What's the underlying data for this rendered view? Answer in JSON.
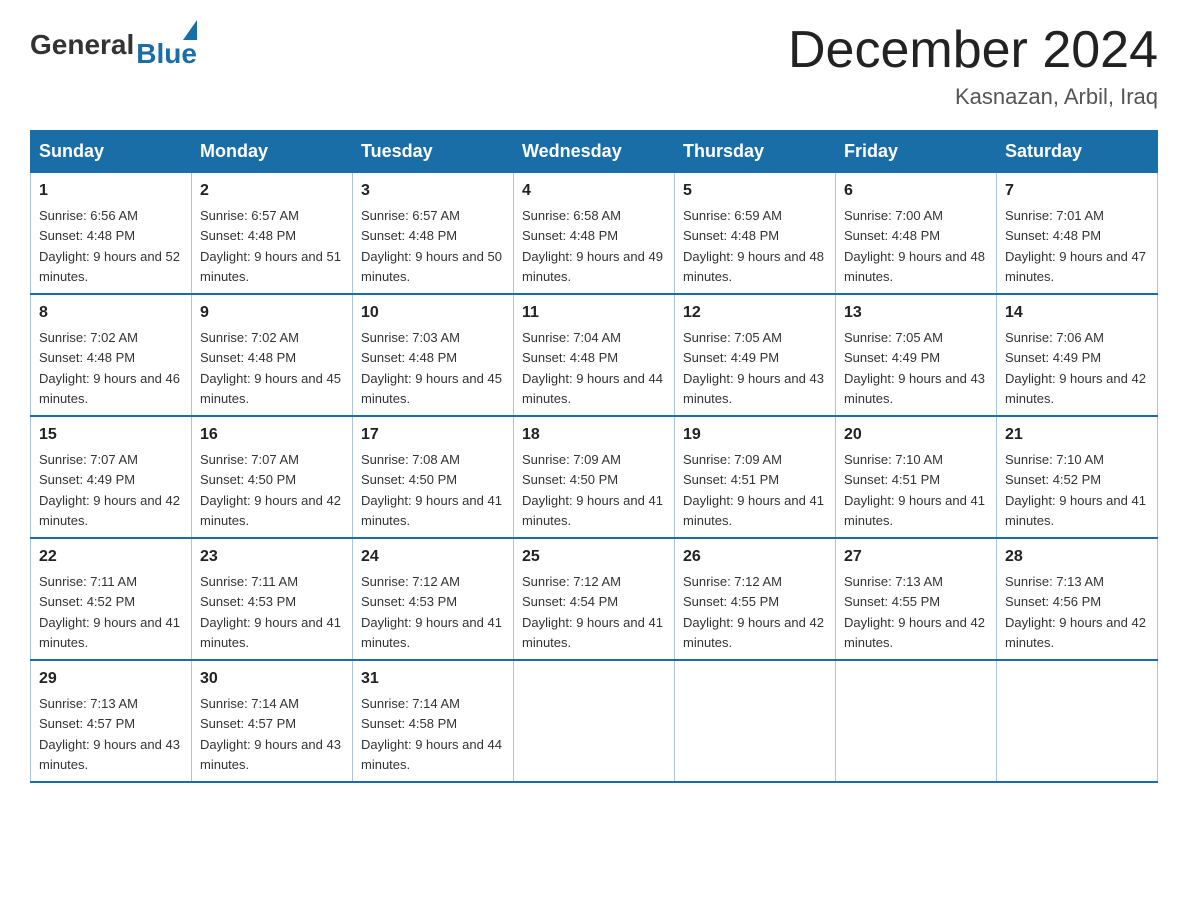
{
  "logo": {
    "general": "General",
    "blue": "Blue"
  },
  "title": {
    "month_year": "December 2024",
    "location": "Kasnazan, Arbil, Iraq"
  },
  "days_of_week": [
    "Sunday",
    "Monday",
    "Tuesday",
    "Wednesday",
    "Thursday",
    "Friday",
    "Saturday"
  ],
  "weeks": [
    [
      {
        "day": "1",
        "sunrise": "6:56 AM",
        "sunset": "4:48 PM",
        "daylight": "9 hours and 52 minutes."
      },
      {
        "day": "2",
        "sunrise": "6:57 AM",
        "sunset": "4:48 PM",
        "daylight": "9 hours and 51 minutes."
      },
      {
        "day": "3",
        "sunrise": "6:57 AM",
        "sunset": "4:48 PM",
        "daylight": "9 hours and 50 minutes."
      },
      {
        "day": "4",
        "sunrise": "6:58 AM",
        "sunset": "4:48 PM",
        "daylight": "9 hours and 49 minutes."
      },
      {
        "day": "5",
        "sunrise": "6:59 AM",
        "sunset": "4:48 PM",
        "daylight": "9 hours and 48 minutes."
      },
      {
        "day": "6",
        "sunrise": "7:00 AM",
        "sunset": "4:48 PM",
        "daylight": "9 hours and 48 minutes."
      },
      {
        "day": "7",
        "sunrise": "7:01 AM",
        "sunset": "4:48 PM",
        "daylight": "9 hours and 47 minutes."
      }
    ],
    [
      {
        "day": "8",
        "sunrise": "7:02 AM",
        "sunset": "4:48 PM",
        "daylight": "9 hours and 46 minutes."
      },
      {
        "day": "9",
        "sunrise": "7:02 AM",
        "sunset": "4:48 PM",
        "daylight": "9 hours and 45 minutes."
      },
      {
        "day": "10",
        "sunrise": "7:03 AM",
        "sunset": "4:48 PM",
        "daylight": "9 hours and 45 minutes."
      },
      {
        "day": "11",
        "sunrise": "7:04 AM",
        "sunset": "4:48 PM",
        "daylight": "9 hours and 44 minutes."
      },
      {
        "day": "12",
        "sunrise": "7:05 AM",
        "sunset": "4:49 PM",
        "daylight": "9 hours and 43 minutes."
      },
      {
        "day": "13",
        "sunrise": "7:05 AM",
        "sunset": "4:49 PM",
        "daylight": "9 hours and 43 minutes."
      },
      {
        "day": "14",
        "sunrise": "7:06 AM",
        "sunset": "4:49 PM",
        "daylight": "9 hours and 42 minutes."
      }
    ],
    [
      {
        "day": "15",
        "sunrise": "7:07 AM",
        "sunset": "4:49 PM",
        "daylight": "9 hours and 42 minutes."
      },
      {
        "day": "16",
        "sunrise": "7:07 AM",
        "sunset": "4:50 PM",
        "daylight": "9 hours and 42 minutes."
      },
      {
        "day": "17",
        "sunrise": "7:08 AM",
        "sunset": "4:50 PM",
        "daylight": "9 hours and 41 minutes."
      },
      {
        "day": "18",
        "sunrise": "7:09 AM",
        "sunset": "4:50 PM",
        "daylight": "9 hours and 41 minutes."
      },
      {
        "day": "19",
        "sunrise": "7:09 AM",
        "sunset": "4:51 PM",
        "daylight": "9 hours and 41 minutes."
      },
      {
        "day": "20",
        "sunrise": "7:10 AM",
        "sunset": "4:51 PM",
        "daylight": "9 hours and 41 minutes."
      },
      {
        "day": "21",
        "sunrise": "7:10 AM",
        "sunset": "4:52 PM",
        "daylight": "9 hours and 41 minutes."
      }
    ],
    [
      {
        "day": "22",
        "sunrise": "7:11 AM",
        "sunset": "4:52 PM",
        "daylight": "9 hours and 41 minutes."
      },
      {
        "day": "23",
        "sunrise": "7:11 AM",
        "sunset": "4:53 PM",
        "daylight": "9 hours and 41 minutes."
      },
      {
        "day": "24",
        "sunrise": "7:12 AM",
        "sunset": "4:53 PM",
        "daylight": "9 hours and 41 minutes."
      },
      {
        "day": "25",
        "sunrise": "7:12 AM",
        "sunset": "4:54 PM",
        "daylight": "9 hours and 41 minutes."
      },
      {
        "day": "26",
        "sunrise": "7:12 AM",
        "sunset": "4:55 PM",
        "daylight": "9 hours and 42 minutes."
      },
      {
        "day": "27",
        "sunrise": "7:13 AM",
        "sunset": "4:55 PM",
        "daylight": "9 hours and 42 minutes."
      },
      {
        "day": "28",
        "sunrise": "7:13 AM",
        "sunset": "4:56 PM",
        "daylight": "9 hours and 42 minutes."
      }
    ],
    [
      {
        "day": "29",
        "sunrise": "7:13 AM",
        "sunset": "4:57 PM",
        "daylight": "9 hours and 43 minutes."
      },
      {
        "day": "30",
        "sunrise": "7:14 AM",
        "sunset": "4:57 PM",
        "daylight": "9 hours and 43 minutes."
      },
      {
        "day": "31",
        "sunrise": "7:14 AM",
        "sunset": "4:58 PM",
        "daylight": "9 hours and 44 minutes."
      },
      null,
      null,
      null,
      null
    ]
  ]
}
